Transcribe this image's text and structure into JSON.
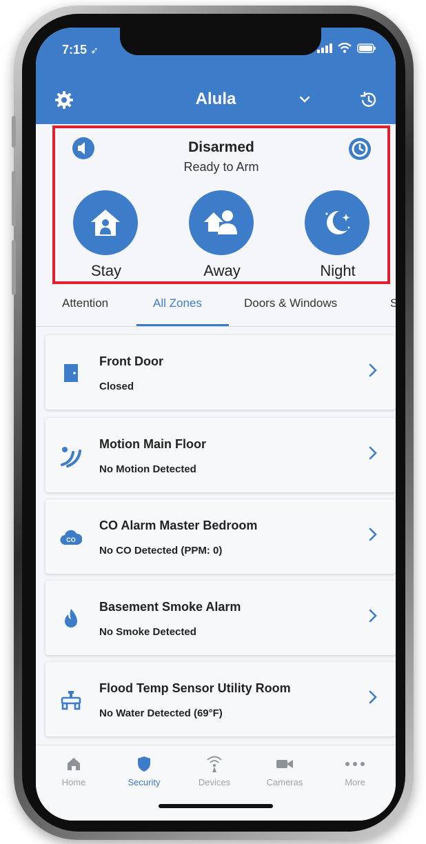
{
  "status_bar": {
    "time": "7:15"
  },
  "header": {
    "title": "Alula"
  },
  "arm_panel": {
    "status": "Disarmed",
    "substatus": "Ready to Arm",
    "modes": [
      {
        "label": "Stay",
        "icon": "house-person-icon"
      },
      {
        "label": "Away",
        "icon": "person-leaving-icon"
      },
      {
        "label": "Night",
        "icon": "moon-stars-icon"
      }
    ]
  },
  "tabs": [
    {
      "label": "Attention",
      "active": false
    },
    {
      "label": "All Zones",
      "active": true
    },
    {
      "label": "Doors & Windows",
      "active": false
    },
    {
      "label": "Sm",
      "active": false
    }
  ],
  "zones": [
    {
      "name": "Front Door",
      "status": "Closed",
      "icon": "door-icon"
    },
    {
      "name": "Motion Main Floor",
      "status": "No Motion Detected",
      "icon": "motion-icon"
    },
    {
      "name": "CO Alarm Master Bedroom",
      "status": "No CO Detected (PPM: 0)",
      "icon": "co-cloud-icon"
    },
    {
      "name": "Basement Smoke Alarm",
      "status": "No Smoke Detected",
      "icon": "flame-icon"
    },
    {
      "name": "Flood Temp Sensor Utility Room",
      "status": "No Water Detected (69°F)",
      "icon": "pipe-icon"
    }
  ],
  "bottom_nav": [
    {
      "label": "Home",
      "icon": "home-icon",
      "active": false
    },
    {
      "label": "Security",
      "icon": "shield-icon",
      "active": true
    },
    {
      "label": "Devices",
      "icon": "wifi-tower-icon",
      "active": false
    },
    {
      "label": "Cameras",
      "icon": "camera-icon",
      "active": false
    },
    {
      "label": "More",
      "icon": "more-dots-icon",
      "active": false
    }
  ],
  "colors": {
    "primary": "#3d7cc9",
    "highlight_border": "#e0202f",
    "inactive": "#9ea3a9"
  }
}
